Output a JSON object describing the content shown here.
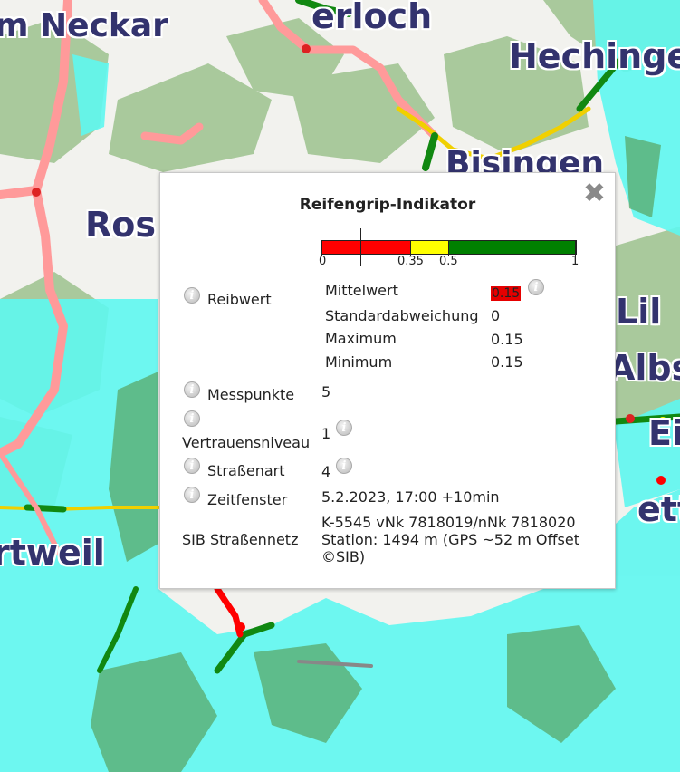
{
  "map": {
    "place_labels": [
      "m Neckar",
      "erloch",
      "Hechinge",
      "Bisingen",
      "Ros",
      "Lil",
      "Albs",
      "Ei",
      "etti",
      "rtweil"
    ]
  },
  "popup": {
    "title": "Reifengrip-Indikator",
    "scale": {
      "labels": [
        "0",
        "0.35",
        "0.5",
        "1"
      ],
      "segments": [
        {
          "from": 0,
          "to": 0.35,
          "color": "#ff0000"
        },
        {
          "from": 0.35,
          "to": 0.5,
          "color": "#ffff00"
        },
        {
          "from": 0.5,
          "to": 1,
          "color": "#008000"
        }
      ],
      "marker_value": 0.15
    },
    "reibwert": {
      "label": "Reibwert",
      "rows": [
        {
          "name": "Mittelwert",
          "value": "0.15"
        },
        {
          "name": "Standardabweichung",
          "value": "0"
        },
        {
          "name": "Maximum",
          "value": "0.15"
        },
        {
          "name": "Minimum",
          "value": "0.15"
        }
      ]
    },
    "messpunkte": {
      "label": "Messpunkte",
      "value": "5"
    },
    "vertrauensniveau": {
      "label": "Vertrauensniveau",
      "value": "1"
    },
    "strassenart": {
      "label": "Straßenart",
      "value": "4"
    },
    "zeitfenster": {
      "label": "Zeitfenster",
      "value": "5.2.2023, 17:00 +10min"
    },
    "sib": {
      "label": "SIB Straßennetz",
      "line1": "K-5545 vNk 7818019/nNk 7818020",
      "line2": "Station: 1494 m (GPS ~52 m Offset",
      "line3": "©SIB)"
    },
    "info_glyph": "i",
    "close_glyph": "✖"
  }
}
